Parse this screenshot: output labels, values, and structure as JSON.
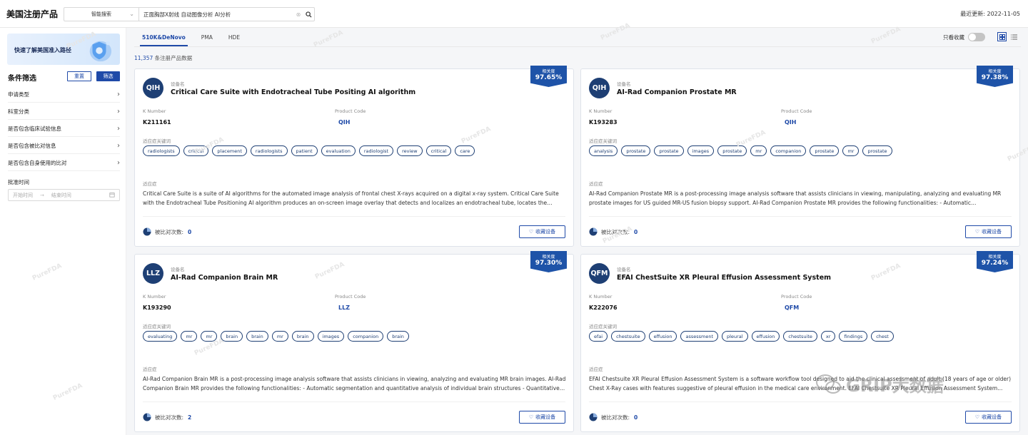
{
  "header": {
    "title": "美国注册产品",
    "search_mode": "智能搜索",
    "search_query": "正面胸部X射线 自动图像分析 AI分析",
    "updated": "最近更新: 2022-11-05"
  },
  "sidebar": {
    "banner": "快速了解美国准入路径",
    "filter_title": "条件筛选",
    "reset_label": "重置",
    "filter_label": "筛选",
    "items": [
      {
        "label": "申请类型"
      },
      {
        "label": "科室分类"
      },
      {
        "label": "是否包含临床试验信息"
      },
      {
        "label": "是否包含被比对信息"
      },
      {
        "label": "是否包含自身使用的比对"
      }
    ],
    "date_label": "批准时间",
    "date_start": "开始时间",
    "date_end": "结束时间"
  },
  "tabs": [
    {
      "label": "510K&DeNovo",
      "active": true
    },
    {
      "label": "PMA",
      "active": false
    },
    {
      "label": "HDE",
      "active": false
    }
  ],
  "only_fav_label": "只看收藏",
  "result_count": "11,357",
  "result_suffix": " 条注册产品数据",
  "labels": {
    "device_name": "设备名",
    "k_number": "K Number",
    "product_code": "Product Code",
    "keywords": "适应症关键词",
    "indication": "适应症",
    "compared": "被比对次数:",
    "favorite": "收藏设备",
    "relevance": "相关度"
  },
  "cards": [
    {
      "code": "QIH",
      "name": "Critical Care Suite with Endotracheal Tube Positing AI algorithm",
      "k_number": "K211161",
      "product_code": "QIH",
      "relevance": "97.65%",
      "keywords": [
        "radiologists",
        "critical",
        "placement",
        "radiologists",
        "patient",
        "evaluation",
        "radiologist",
        "review",
        "critical",
        "care"
      ],
      "description": "Critical Care Suite is a suite of AI algorithms for the automated image analysis of frontal chest X-rays acquired on a digital x-ray system. Critical Care Suite with the Endotracheal Tube Positioning AI algorithm produces an on-screen image overlay that detects and localizes an endotracheal tube, locates the…",
      "compared": "0"
    },
    {
      "code": "QIH",
      "name": "AI-Rad Companion Prostate MR",
      "k_number": "K193283",
      "product_code": "QIH",
      "relevance": "97.38%",
      "keywords": [
        "analysis",
        "prostate",
        "prostate",
        "images",
        "prostate",
        "mr",
        "companion",
        "prostate",
        "mr",
        "prostate"
      ],
      "description": "AI-Rad Companion Prostate MR is a post-processing image analysis software that assists clinicians in viewing, manipulating, analyzing and evaluating MR prostate images for US guided MR-US fusion biopsy support. AI-Rad Companion Prostate MR provides the following functionalities: - Automatic…",
      "compared": "0"
    },
    {
      "code": "LLZ",
      "name": "AI-Rad Companion Brain MR",
      "k_number": "K193290",
      "product_code": "LLZ",
      "relevance": "97.30%",
      "keywords": [
        "evaluating",
        "mr",
        "mr",
        "brain",
        "brain",
        "mr",
        "brain",
        "images",
        "companion",
        "brain"
      ],
      "description": "AI-Rad Companion Brain MR is a post-processing image analysis software that assists clinicians in viewing, analyzing and evaluating MR brain images. AI-Rad Companion Brain MR provides the following functionalities: - Automatic segmentation and quantitative analysis of individual brain structures - Quantitative…",
      "compared": "2"
    },
    {
      "code": "QFM",
      "name": "EFAI ChestSuite XR Pleural Effusion Assessment System",
      "k_number": "K222076",
      "product_code": "QFM",
      "relevance": "97.24%",
      "keywords": [
        "efai",
        "chestsuite",
        "effusion",
        "assessment",
        "pleural",
        "effusion",
        "chestsuite",
        "xr",
        "findings",
        "chest"
      ],
      "description": "EFAI Chestsuite XR Pleural Effusion Assessment System is a software workflow tool designed to aid the clinical assessment of adult (18 years of age or older) Chest X-Ray cases with features suggestive of pleural effusion in the medical care environment. EFAI Chestsuite XR Pleural Effusion Assessment System...",
      "compared": "0"
    }
  ],
  "watermark": "PureFDA",
  "overlay_watermark": "GRIP大数据",
  "colors": {
    "accent": "#1f4aa8",
    "avatar": "#1e3f74",
    "badge": "#1e53a8"
  }
}
